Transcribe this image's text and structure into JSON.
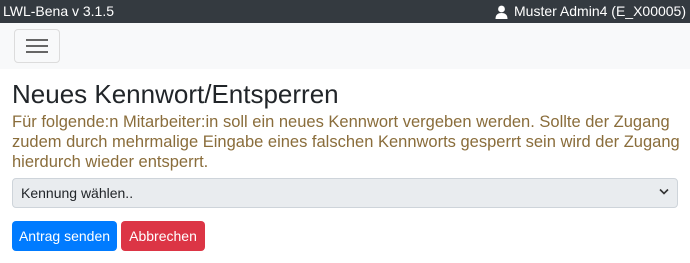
{
  "topbar": {
    "app_title": "LWL-Bena v 3.1.5",
    "user_label": "Muster Admin4 (E_X00005)",
    "user_icon": "user-icon"
  },
  "navbar": {
    "menu_icon": "hamburger-icon"
  },
  "main": {
    "heading": "Neues Kennwort/Entsperren",
    "info_text": "Für folgende:n Mitarbeiter:in soll ein neues Kennwort vergeben werden. Sollte der Zugang zudem durch mehrmalige Eingabe eines falschen Kennworts gesperrt sein wird der Zugang hierdurch wieder entsperrt.",
    "select_value": "Kennung wählen..",
    "submit_label": "Antrag senden",
    "cancel_label": "Abbrechen"
  },
  "colors": {
    "topbar_bg": "#343a40",
    "info_text": "#8a6d3b",
    "primary": "#007bff",
    "danger": "#dc3545"
  }
}
